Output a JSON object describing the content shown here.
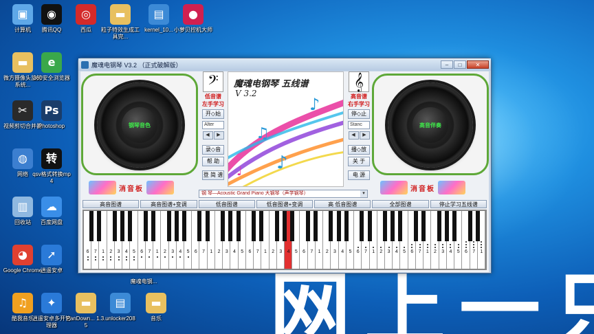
{
  "desktop": {
    "icons": [
      {
        "label": "计算机",
        "icon": "computer-icon",
        "color": "#5fa8e8",
        "glyph": "▣"
      },
      {
        "label": "腾讯QQ",
        "icon": "qq-icon",
        "color": "#111111",
        "glyph": "◉"
      },
      {
        "label": "西瓜",
        "icon": "watermelon-icon",
        "color": "#d42a2a",
        "glyph": "◎"
      },
      {
        "label": "粒子特效生成工具完...",
        "icon": "folder-icon",
        "color": "#e8c060",
        "glyph": "▬"
      },
      {
        "label": "kernel_10...",
        "icon": "archive-icon",
        "color": "#3c8ad6",
        "glyph": "▤"
      },
      {
        "label": "小萝贝控机大师",
        "icon": "radish-icon",
        "color": "#d02050",
        "glyph": "●"
      },
      {
        "label": "微方摄像头监控系统...",
        "icon": "folder-icon",
        "color": "#e8c060",
        "glyph": "▬"
      },
      {
        "label": "360安全浏览器",
        "icon": "browser-360-icon",
        "color": "#3aa84a",
        "glyph": "e"
      },
      {
        "label": "视频剪切合并器",
        "icon": "video-cut-icon",
        "color": "#2a2a2a",
        "glyph": "✂"
      },
      {
        "label": "Photoshop",
        "icon": "photoshop-icon",
        "color": "#1a3d6a",
        "glyph": "Ps"
      },
      {
        "label": "网络",
        "icon": "network-icon",
        "color": "#3c7fd0",
        "glyph": "◍"
      },
      {
        "label": "qsv格式转换mp4",
        "icon": "convert-icon",
        "color": "#111111",
        "glyph": "转"
      },
      {
        "label": "回收站",
        "icon": "recycle-bin-icon",
        "color": "#8fb8e0",
        "glyph": "▥"
      },
      {
        "label": "百度网盘",
        "icon": "baidu-pan-icon",
        "color": "#3a8ee8",
        "glyph": "☁"
      },
      {
        "label": "Google Chrome",
        "icon": "chrome-icon",
        "color": "#e04030",
        "glyph": "◕"
      },
      {
        "label": "逍遥安卓",
        "icon": "xiaoyao-icon",
        "color": "#2a7ad8",
        "glyph": "➚"
      },
      {
        "label": "酷我音乐",
        "icon": "kuwo-icon",
        "color": "#f0a020",
        "glyph": "♫"
      },
      {
        "label": "逍遥安卓多开管理器",
        "icon": "xiaoyao-multi-icon",
        "color": "#2a7ad8",
        "glyph": "✦"
      },
      {
        "label": "PanDown... 1.3.5",
        "icon": "folder-icon",
        "color": "#e8c060",
        "glyph": "▬"
      },
      {
        "label": "unlocker208",
        "icon": "archive-icon",
        "color": "#3c8ad6",
        "glyph": "▤"
      },
      {
        "label": "音乐",
        "icon": "folder-icon",
        "color": "#e8c060",
        "glyph": "▬"
      }
    ],
    "partial_label_under_window": "魔魂电钢...",
    "bg_text": "网上一只虫"
  },
  "window": {
    "title": "魔魂电钢琴 V3.2 （正式破解版）",
    "controls": {
      "minimize": "–",
      "maximize": "□",
      "close": "✕"
    },
    "left_speaker_label": "钢琴音色",
    "right_speaker_label": "高音伴奏",
    "left_col": {
      "clef": "𝄢",
      "label_1": "低音谱",
      "label_2": "左手学习",
      "btn_start": "开◇始",
      "select": "Alter",
      "arrow_left": "◀",
      "arrow_right": "▶",
      "btn_record": "录◇音",
      "btn_help": "帮 助",
      "btn_login": "登 简 谱"
    },
    "right_col": {
      "clef": "𝄞",
      "label_1": "高音谱",
      "label_2": "右手学习",
      "btn_stop": "停◇止",
      "select": "Stanc",
      "arrow_left": "◀",
      "arrow_right": "▶",
      "btn_play": "播◇放",
      "btn_about": "关 于",
      "btn_power": "电 源"
    },
    "banner": {
      "title": "魔魂电钢琴 五线谱",
      "version": "V 3.2"
    },
    "deco_left": "消音板",
    "deco_right": "消音板",
    "instrument": "钢    琴—Acoustic Grand Piano  大钢琴（声学钢琴）",
    "tabs": [
      "高音图谱",
      "高音图谱+变调",
      "低音图谱",
      "低音图谱+变调",
      "高 低音图谱",
      "全部图谱",
      "停止学习五线谱"
    ],
    "piano": {
      "white_key_count": 52,
      "active_white_key_index": 26,
      "black_pattern": [
        1,
        1,
        0,
        1,
        1,
        1,
        0
      ],
      "numbers": [
        "6",
        "7",
        "1",
        "2",
        "3",
        "4",
        "5",
        "6",
        "7",
        "1",
        "2",
        "3",
        "4",
        "5",
        "6",
        "7",
        "1",
        "2",
        "3",
        "4",
        "5",
        "6",
        "7",
        "1",
        "2",
        "3",
        "4",
        "5",
        "6",
        "7",
        "1",
        "2",
        "3",
        "4",
        "5",
        "6",
        "7",
        "1",
        "2",
        "3",
        "4",
        "5",
        "6",
        "7",
        "1",
        "2",
        "3",
        "4",
        "5",
        "6",
        "7",
        "1"
      ]
    }
  }
}
